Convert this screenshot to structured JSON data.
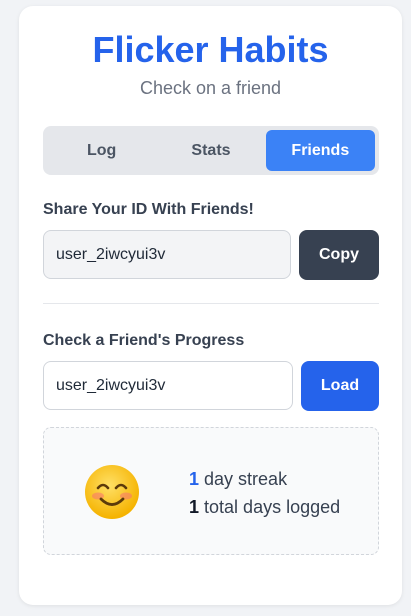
{
  "app": {
    "title": "Flicker Habits",
    "subtitle": "Check on a friend"
  },
  "tabs": [
    {
      "label": "Log",
      "active": false
    },
    {
      "label": "Stats",
      "active": false
    },
    {
      "label": "Friends",
      "active": true
    }
  ],
  "share": {
    "heading": "Share Your ID With Friends!",
    "user_id": "user_2iwcyui3v",
    "copy_label": "Copy"
  },
  "friend": {
    "heading": "Check a Friend's Progress",
    "input_value": "user_2iwcyui3v",
    "load_label": "Load",
    "emoji": "smiling-face-icon",
    "streak_count": "1",
    "streak_text": "day streak",
    "total_count": "1",
    "total_text": "total days logged"
  },
  "colors": {
    "brand": "#2563eb",
    "tab_active": "#3b82f6",
    "dark_button": "#374151",
    "text_muted": "#6b7280",
    "text_dark": "#374151",
    "tab_inactive_text": "#4b5563",
    "emoji_face": "#fcc419",
    "emoji_cheek": "#f87171"
  }
}
